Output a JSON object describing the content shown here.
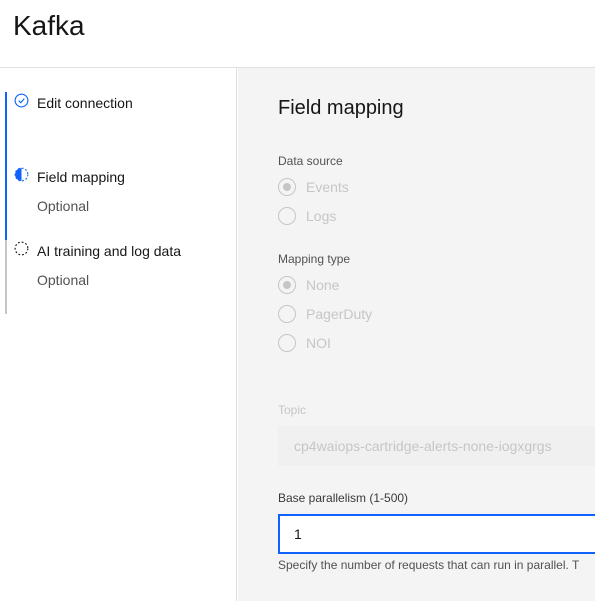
{
  "app": {
    "title": "Kafka"
  },
  "steps": [
    {
      "label": "Edit connection",
      "sub": "",
      "state": "complete"
    },
    {
      "label": "Field mapping",
      "sub": "Optional",
      "state": "current"
    },
    {
      "label": "AI training and log data",
      "sub": "Optional",
      "state": "incomplete"
    }
  ],
  "main": {
    "title": "Field mapping",
    "data_source": {
      "label": "Data source",
      "options": [
        "Events",
        "Logs"
      ],
      "selected": "Events"
    },
    "mapping_type": {
      "label": "Mapping type",
      "options": [
        "None",
        "PagerDuty",
        "NOI"
      ],
      "selected": "None"
    },
    "topic": {
      "label": "Topic",
      "value": "cp4waiops-cartridge-alerts-none-iogxgrgs"
    },
    "base_parallelism": {
      "label": "Base parallelism (1-500)",
      "value": "1",
      "helper": "Specify the number of requests that can run in parallel. T"
    }
  },
  "colors": {
    "accent": "#0f62fe",
    "disabled": "#c6c6c6",
    "panel_bg": "#f4f4f4",
    "step_bar": "#8d8d8d"
  },
  "icons": {
    "step_complete": "checkmark-outline-icon",
    "step_current": "half-circle-icon",
    "step_incomplete": "dashed-circle-icon"
  }
}
